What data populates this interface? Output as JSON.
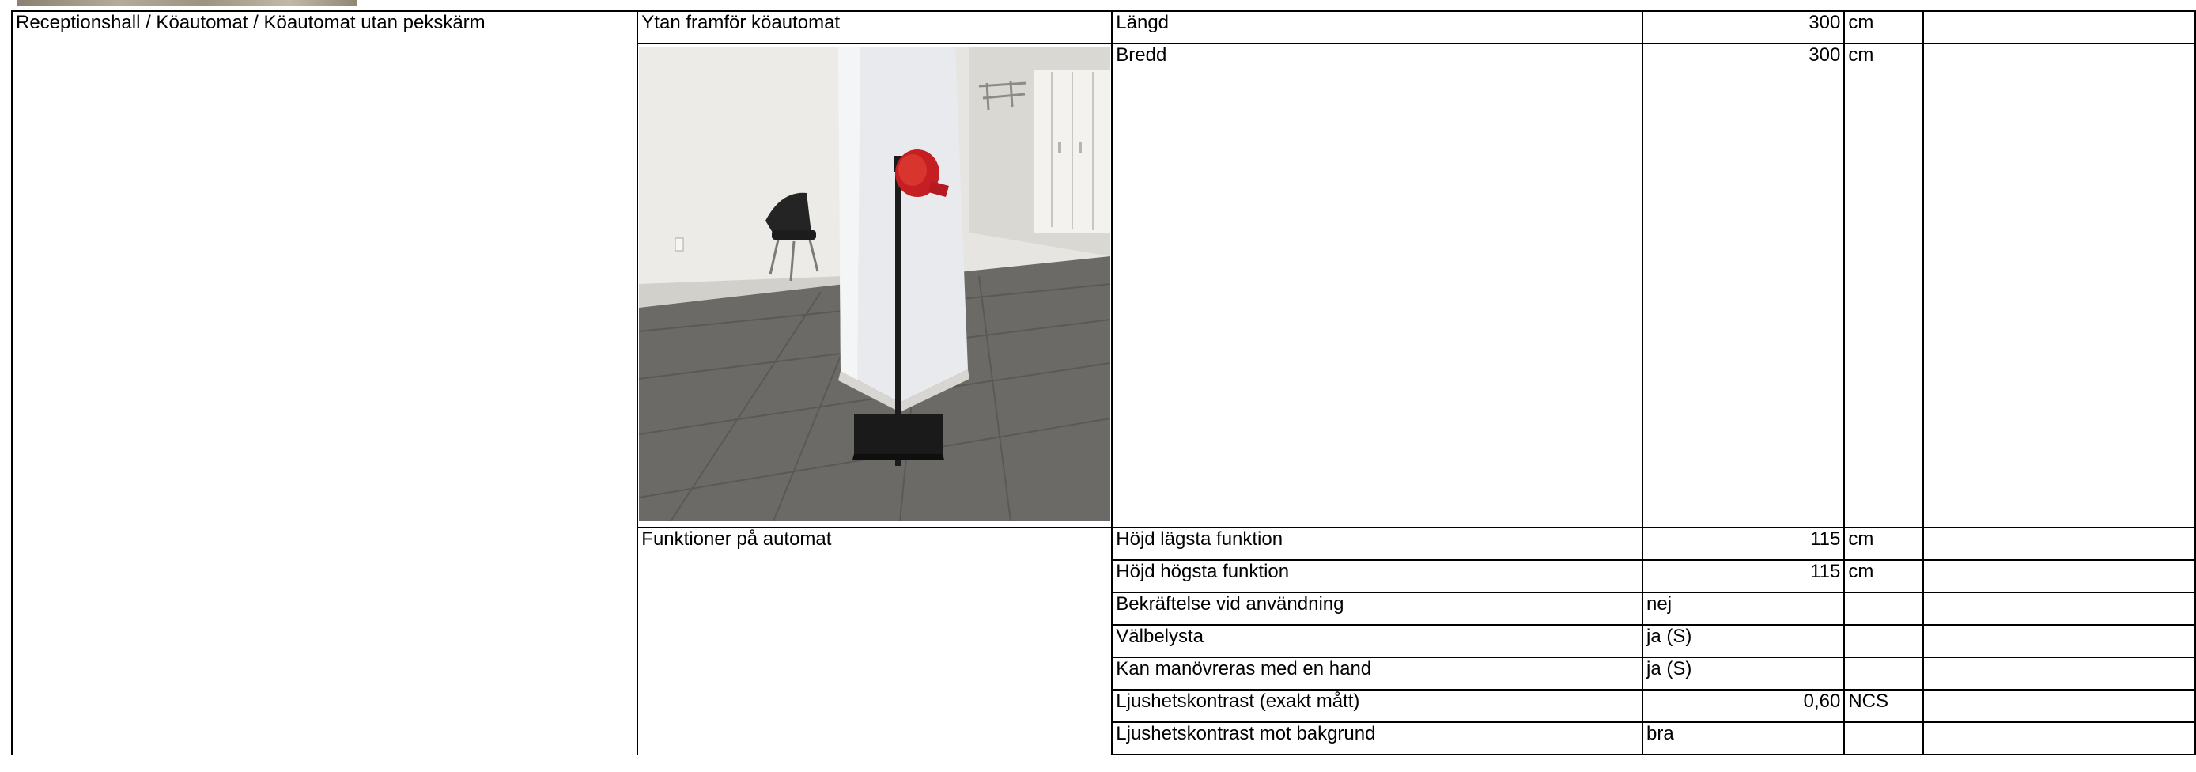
{
  "location": {
    "path": "Receptionshall / Köautomat / Köautomat utan pekskärm"
  },
  "groups": {
    "surface": "Ytan framför köautomat",
    "functions": "Funktioner på automat"
  },
  "rows": [
    {
      "label": "Längd",
      "value": "300",
      "unit": "cm"
    },
    {
      "label": "Bredd",
      "value": "300",
      "unit": "cm"
    },
    {
      "label": "Höjd lägsta funktion",
      "value": "115",
      "unit": "cm"
    },
    {
      "label": "Höjd högsta funktion",
      "value": "115",
      "unit": "cm"
    },
    {
      "label": "Bekräftelse vid användning",
      "value": "nej",
      "unit": ""
    },
    {
      "label": "Välbelysta",
      "value": "ja (S)",
      "unit": ""
    },
    {
      "label": "Kan manövreras med en hand",
      "value": "ja (S)",
      "unit": ""
    },
    {
      "label": "Ljushetskontrast (exakt mått)",
      "value": "0,60",
      "unit": "NCS"
    },
    {
      "label": "Ljushetskontrast mot bakgrund",
      "value": "bra",
      "unit": ""
    }
  ]
}
